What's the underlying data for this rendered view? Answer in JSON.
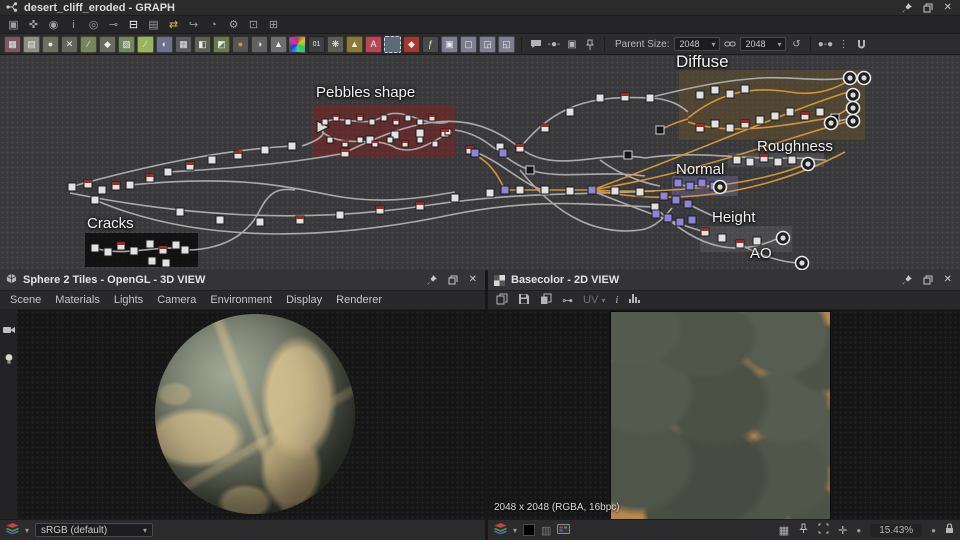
{
  "colors": {
    "wire_grey": "#b5b5b5",
    "wire_accent": "#e09b35",
    "node_red": "#9e2a23",
    "node_purple": "#8d86d8",
    "frame_pebbles": "#7d2321",
    "frame_cracks": "#0a0a0a",
    "frame_diffuse": "#64502d",
    "frame_normal": "#706caa",
    "frame_height": "#808084"
  },
  "graph_panel": {
    "title": "desert_cliff_eroded - GRAPH",
    "frames": [
      {
        "label": "Pebbles shape"
      },
      {
        "label": "Cracks"
      },
      {
        "label": "Diffuse"
      },
      {
        "label": "Roughness"
      },
      {
        "label": "Normal"
      },
      {
        "label": "Height"
      },
      {
        "label": "AO"
      }
    ],
    "toolbar": {
      "parent_size_label": "Parent Size:",
      "parent_size_value": "2048",
      "size_value": "2048",
      "text_node_glyph": "A",
      "fx_glyph": "01"
    }
  },
  "view3d": {
    "title": "Sphere 2 Tiles - OpenGL - 3D VIEW",
    "menus": [
      "Scene",
      "Materials",
      "Lights",
      "Camera",
      "Environment",
      "Display",
      "Renderer"
    ],
    "colorspace": "sRGB (default)"
  },
  "view2d": {
    "title": "Basecolor - 2D VIEW",
    "uv_label": "UV",
    "info_glyph": "i",
    "status": "2048 x 2048 (RGBA, 16bpc)",
    "zoom_level": "15.43%"
  }
}
